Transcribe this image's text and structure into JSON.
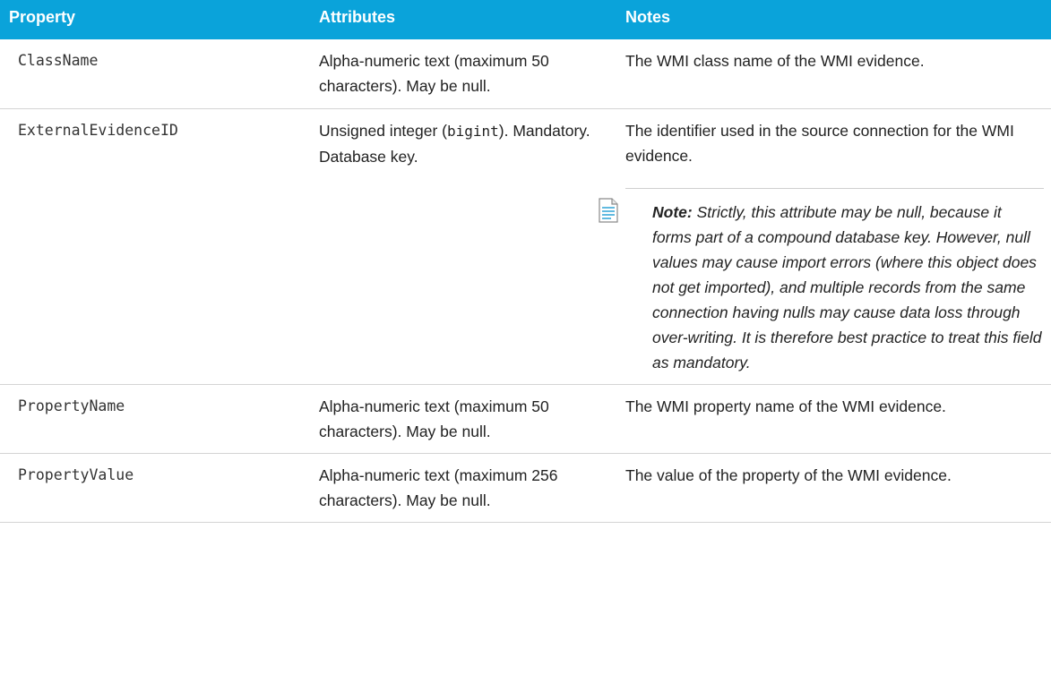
{
  "table": {
    "headers": {
      "property": "Property",
      "attributes": "Attributes",
      "notes": "Notes"
    },
    "rows": [
      {
        "property": "ClassName",
        "attributes": "Alpha-numeric text (maximum 50 characters). May be null.",
        "notes": "The WMI class name of the WMI evidence."
      },
      {
        "property": "ExternalEvidenceID",
        "attributes_pre": "Unsigned integer (",
        "attributes_code": "bigint",
        "attributes_post": "). Mandatory. Database key.",
        "notes": "The identifier used in the source connection for the WMI evidence.",
        "note_label": "Note:",
        "note_text": "Strictly, this attribute may be null, because it forms part of a compound database key. However, null values may cause import errors (where this object does not get imported), and multiple records from the same connection having nulls may cause data loss through over-writing. It is therefore best practice to treat this field as mandatory."
      },
      {
        "property": "PropertyName",
        "attributes": "Alpha-numeric text (maximum 50 characters). May be null.",
        "notes": "The WMI property name of the WMI evidence."
      },
      {
        "property": "PropertyValue",
        "attributes": "Alpha-numeric text (maximum 256 characters). May be null.",
        "notes": "The value of the property of the WMI evidence."
      }
    ]
  },
  "colors": {
    "header_bg": "#0aa3da",
    "header_text": "#ffffff",
    "row_border": "#d4d4d4"
  },
  "icons": {
    "note": "note-document-icon"
  }
}
